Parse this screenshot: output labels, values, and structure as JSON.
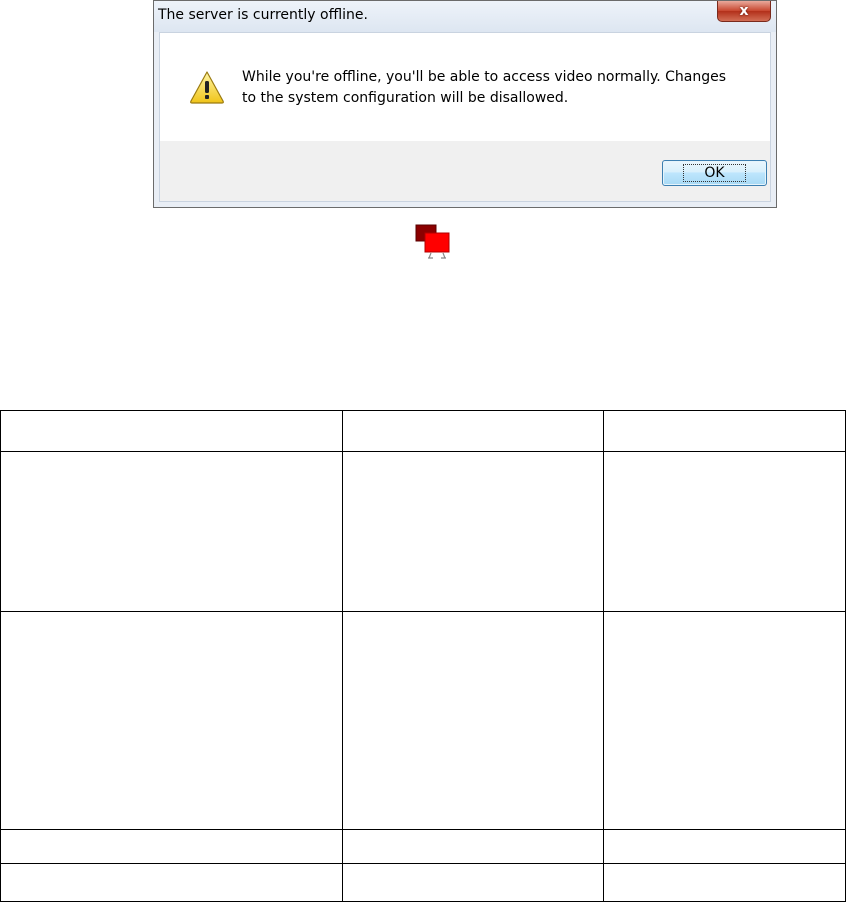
{
  "dialog": {
    "title": "The server is currently offline.",
    "close_label": "x",
    "message": "While you're offline, you'll be able to access video normally. Changes to the system configuration will be disallowed.",
    "ok_label": "OK",
    "icon": "warning-icon"
  },
  "status_icon": "network-offline-icon",
  "table": {
    "rows": [
      [
        "",
        "",
        ""
      ],
      [
        "",
        "",
        ""
      ],
      [
        "",
        "",
        ""
      ],
      [
        "",
        "",
        ""
      ],
      [
        "",
        "",
        ""
      ]
    ]
  },
  "colors": {
    "close_button": "#c7452d",
    "network_icon_red": "#ff0000",
    "network_icon_dark": "#8b0000"
  }
}
